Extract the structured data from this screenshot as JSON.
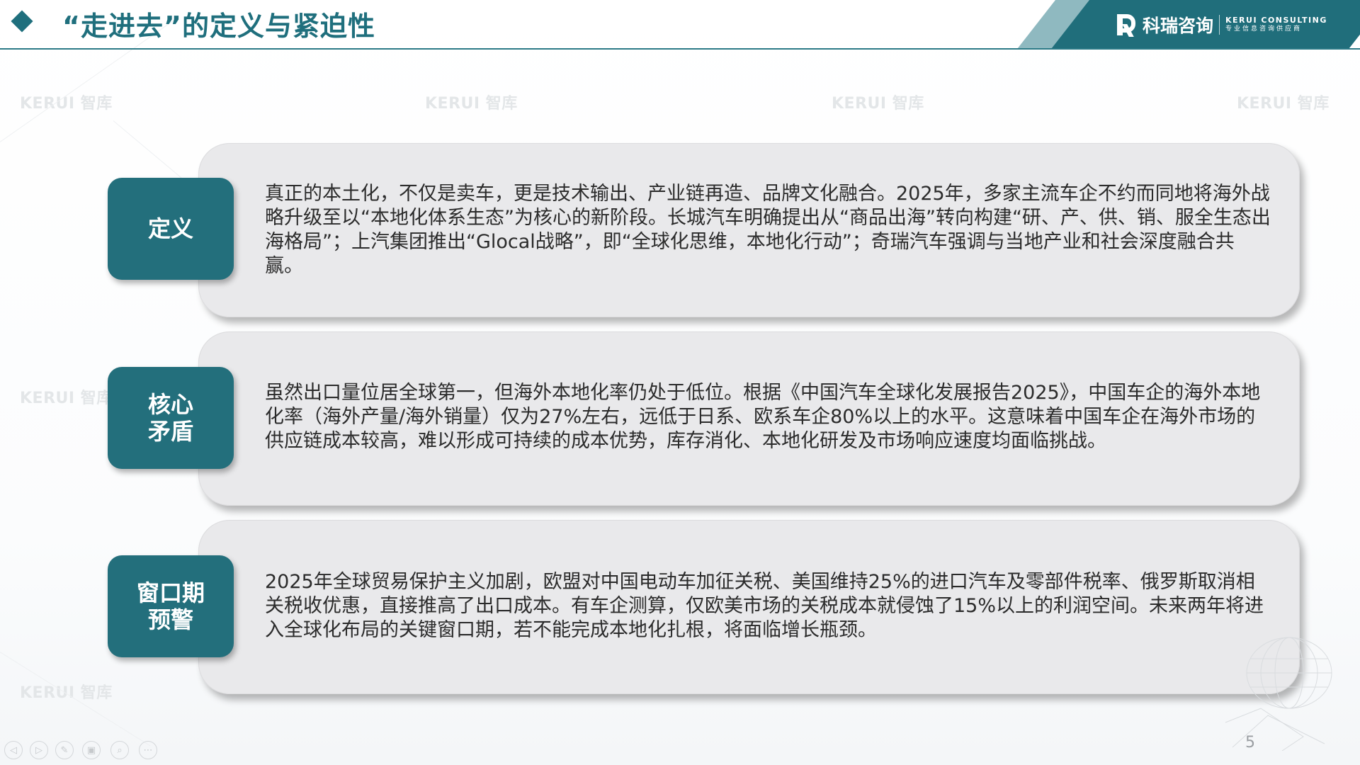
{
  "header": {
    "title": "“走进去”的定义与紧迫性",
    "brand_cn": "科瑞咨询",
    "brand_en_line1": "KERUI CONSULTING",
    "brand_en_line2": "专业信息咨询供应商"
  },
  "watermark": {
    "text": "KERUI 智库"
  },
  "cards": [
    {
      "tag": "定义",
      "text": "真正的本土化，不仅是卖车，更是技术输出、产业链再造、品牌文化融合。2025年，多家主流车企不约而同地将海外战略升级至以“本地化体系生态”为核心的新阶段。长城汽车明确提出从“商品出海”转向构建“研、产、供、销、服全生态出海格局”；上汽集团推出“Glocal战略”，即“全球化思维，本地化行动”；奇瑞汽车强调与当地产业和社会深度融合共赢。"
    },
    {
      "tag": "核心\n矛盾",
      "text": "虽然出口量位居全球第一，但海外本地化率仍处于低位。根据《中国汽车全球化发展报告2025》，中国车企的海外本地化率（海外产量/海外销量）仅为27%左右，远低于日系、欧系车企80%以上的水平。这意味着中国车企在海外市场的供应链成本较高，难以形成可持续的成本优势，库存消化、本地化研发及市场响应速度均面临挑战。"
    },
    {
      "tag": "窗口期\n预警",
      "text": "2025年全球贸易保护主义加剧，欧盟对中国电动车加征关税、美国维持25%的进口汽车及零部件税率、俄罗斯取消相关税收优惠，直接推高了出口成本。有车企测算，仅欧美市场的关税成本就侵蚀了15%以上的利润空间。未来两年将进入全球化布局的关键窗口期，若不能完成本地化扎根，将面临增长瓶颈。"
    }
  ],
  "footer": {
    "page_number": "5"
  },
  "controls": [
    {
      "icon": "previous-icon",
      "glyph": "◁"
    },
    {
      "icon": "next-icon",
      "glyph": "▷"
    },
    {
      "icon": "pen-icon",
      "glyph": "✎"
    },
    {
      "icon": "slides-icon",
      "glyph": "▣"
    },
    {
      "icon": "zoom-icon",
      "glyph": "⌕"
    },
    {
      "icon": "more-icon",
      "glyph": "⋯"
    }
  ],
  "colors": {
    "accent": "#236f7c",
    "card_bg": "#e9e9eb",
    "text": "#2b2b2b"
  }
}
